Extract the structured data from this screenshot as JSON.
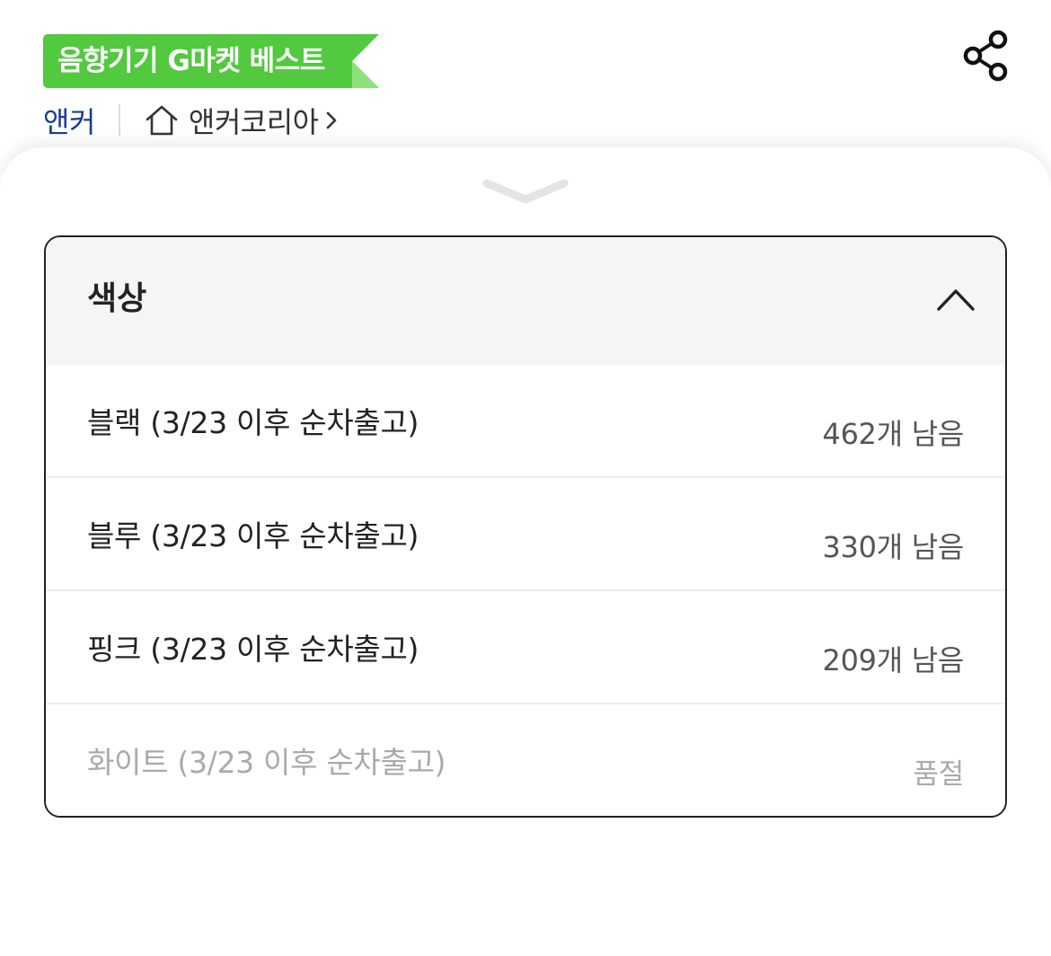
{
  "header": {
    "badge_text": "음향기기 G마켓 베스트",
    "brand": "앤커",
    "store_name": "앤커코리아"
  },
  "options": {
    "title": "색상",
    "items": [
      {
        "name": "블랙 (3/23 이후 순차출고)",
        "stock": "462개 남음",
        "sold_out": false
      },
      {
        "name": "블루 (3/23 이후 순차출고)",
        "stock": "330개 남음",
        "sold_out": false
      },
      {
        "name": "핑크 (3/23 이후 순차출고)",
        "stock": "209개 남음",
        "sold_out": false
      },
      {
        "name": "화이트 (3/23 이후 순차출고)",
        "stock": "품절",
        "sold_out": true
      }
    ]
  },
  "colors": {
    "badge_green": "#52c93f",
    "badge_green_light": "#8ee07a",
    "brand_blue": "#1a3c94",
    "border_dark": "#222222",
    "header_bg": "#f5f5f5",
    "sold_out_gray": "#aaaaaa"
  },
  "icons": {
    "share": "share-icon",
    "home": "home-icon",
    "chevron_right": "chevron-right-icon",
    "sheet_handle": "chevron-down-icon",
    "collapse": "chevron-up-icon"
  }
}
